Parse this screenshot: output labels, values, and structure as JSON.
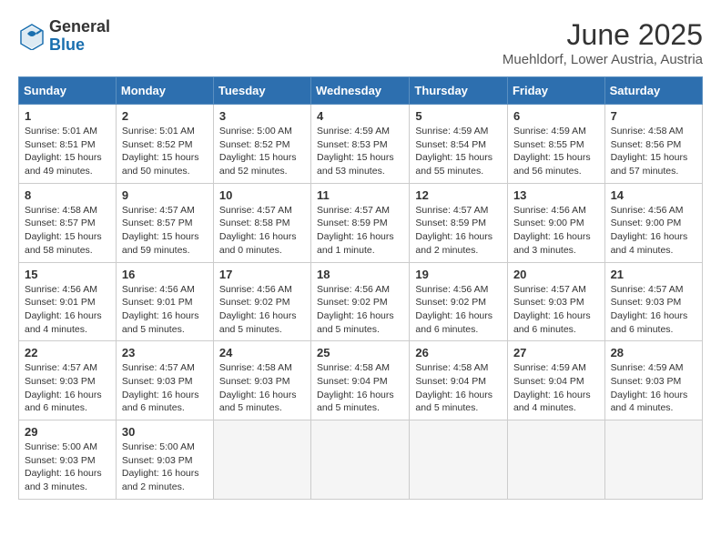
{
  "header": {
    "logo_general": "General",
    "logo_blue": "Blue",
    "month_year": "June 2025",
    "location": "Muehldorf, Lower Austria, Austria"
  },
  "weekdays": [
    "Sunday",
    "Monday",
    "Tuesday",
    "Wednesday",
    "Thursday",
    "Friday",
    "Saturday"
  ],
  "weeks": [
    [
      {
        "day": "1",
        "info": "Sunrise: 5:01 AM\nSunset: 8:51 PM\nDaylight: 15 hours\nand 49 minutes."
      },
      {
        "day": "2",
        "info": "Sunrise: 5:01 AM\nSunset: 8:52 PM\nDaylight: 15 hours\nand 50 minutes."
      },
      {
        "day": "3",
        "info": "Sunrise: 5:00 AM\nSunset: 8:52 PM\nDaylight: 15 hours\nand 52 minutes."
      },
      {
        "day": "4",
        "info": "Sunrise: 4:59 AM\nSunset: 8:53 PM\nDaylight: 15 hours\nand 53 minutes."
      },
      {
        "day": "5",
        "info": "Sunrise: 4:59 AM\nSunset: 8:54 PM\nDaylight: 15 hours\nand 55 minutes."
      },
      {
        "day": "6",
        "info": "Sunrise: 4:59 AM\nSunset: 8:55 PM\nDaylight: 15 hours\nand 56 minutes."
      },
      {
        "day": "7",
        "info": "Sunrise: 4:58 AM\nSunset: 8:56 PM\nDaylight: 15 hours\nand 57 minutes."
      }
    ],
    [
      {
        "day": "8",
        "info": "Sunrise: 4:58 AM\nSunset: 8:57 PM\nDaylight: 15 hours\nand 58 minutes."
      },
      {
        "day": "9",
        "info": "Sunrise: 4:57 AM\nSunset: 8:57 PM\nDaylight: 15 hours\nand 59 minutes."
      },
      {
        "day": "10",
        "info": "Sunrise: 4:57 AM\nSunset: 8:58 PM\nDaylight: 16 hours\nand 0 minutes."
      },
      {
        "day": "11",
        "info": "Sunrise: 4:57 AM\nSunset: 8:59 PM\nDaylight: 16 hours\nand 1 minute."
      },
      {
        "day": "12",
        "info": "Sunrise: 4:57 AM\nSunset: 8:59 PM\nDaylight: 16 hours\nand 2 minutes."
      },
      {
        "day": "13",
        "info": "Sunrise: 4:56 AM\nSunset: 9:00 PM\nDaylight: 16 hours\nand 3 minutes."
      },
      {
        "day": "14",
        "info": "Sunrise: 4:56 AM\nSunset: 9:00 PM\nDaylight: 16 hours\nand 4 minutes."
      }
    ],
    [
      {
        "day": "15",
        "info": "Sunrise: 4:56 AM\nSunset: 9:01 PM\nDaylight: 16 hours\nand 4 minutes."
      },
      {
        "day": "16",
        "info": "Sunrise: 4:56 AM\nSunset: 9:01 PM\nDaylight: 16 hours\nand 5 minutes."
      },
      {
        "day": "17",
        "info": "Sunrise: 4:56 AM\nSunset: 9:02 PM\nDaylight: 16 hours\nand 5 minutes."
      },
      {
        "day": "18",
        "info": "Sunrise: 4:56 AM\nSunset: 9:02 PM\nDaylight: 16 hours\nand 5 minutes."
      },
      {
        "day": "19",
        "info": "Sunrise: 4:56 AM\nSunset: 9:02 PM\nDaylight: 16 hours\nand 6 minutes."
      },
      {
        "day": "20",
        "info": "Sunrise: 4:57 AM\nSunset: 9:03 PM\nDaylight: 16 hours\nand 6 minutes."
      },
      {
        "day": "21",
        "info": "Sunrise: 4:57 AM\nSunset: 9:03 PM\nDaylight: 16 hours\nand 6 minutes."
      }
    ],
    [
      {
        "day": "22",
        "info": "Sunrise: 4:57 AM\nSunset: 9:03 PM\nDaylight: 16 hours\nand 6 minutes."
      },
      {
        "day": "23",
        "info": "Sunrise: 4:57 AM\nSunset: 9:03 PM\nDaylight: 16 hours\nand 6 minutes."
      },
      {
        "day": "24",
        "info": "Sunrise: 4:58 AM\nSunset: 9:03 PM\nDaylight: 16 hours\nand 5 minutes."
      },
      {
        "day": "25",
        "info": "Sunrise: 4:58 AM\nSunset: 9:04 PM\nDaylight: 16 hours\nand 5 minutes."
      },
      {
        "day": "26",
        "info": "Sunrise: 4:58 AM\nSunset: 9:04 PM\nDaylight: 16 hours\nand 5 minutes."
      },
      {
        "day": "27",
        "info": "Sunrise: 4:59 AM\nSunset: 9:04 PM\nDaylight: 16 hours\nand 4 minutes."
      },
      {
        "day": "28",
        "info": "Sunrise: 4:59 AM\nSunset: 9:03 PM\nDaylight: 16 hours\nand 4 minutes."
      }
    ],
    [
      {
        "day": "29",
        "info": "Sunrise: 5:00 AM\nSunset: 9:03 PM\nDaylight: 16 hours\nand 3 minutes."
      },
      {
        "day": "30",
        "info": "Sunrise: 5:00 AM\nSunset: 9:03 PM\nDaylight: 16 hours\nand 2 minutes."
      },
      {
        "day": "",
        "info": ""
      },
      {
        "day": "",
        "info": ""
      },
      {
        "day": "",
        "info": ""
      },
      {
        "day": "",
        "info": ""
      },
      {
        "day": "",
        "info": ""
      }
    ]
  ]
}
